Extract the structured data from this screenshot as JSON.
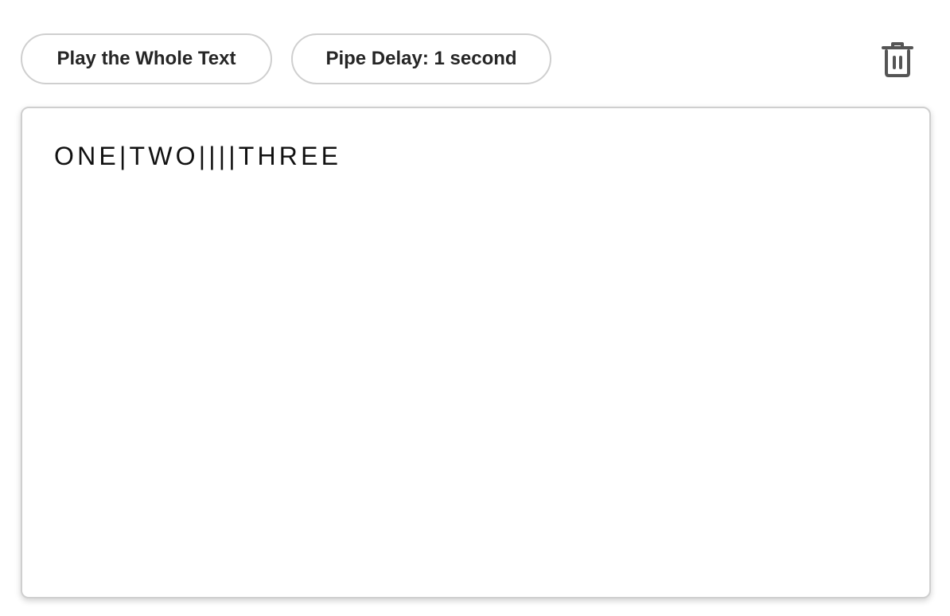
{
  "toolbar": {
    "play_label": "Play the Whole Text",
    "delay_label": "Pipe Delay: 1 second",
    "clear_icon": "trash-icon"
  },
  "editor": {
    "text": "ONE|TWO||||THREE"
  },
  "colors": {
    "border": "#cfcfcf",
    "text": "#111111",
    "icon": "#555555",
    "background": "#ffffff"
  }
}
